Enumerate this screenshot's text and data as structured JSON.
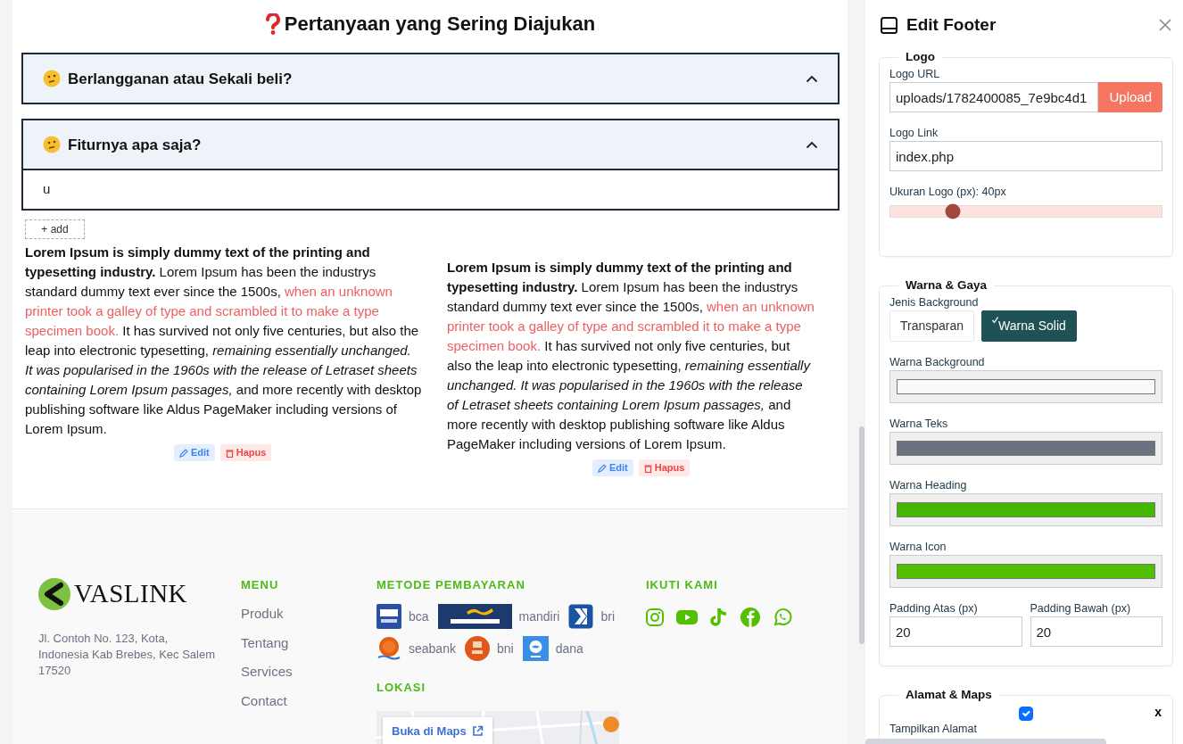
{
  "faq": {
    "title": "Pertanyaan yang Sering Diajukan",
    "items": [
      {
        "question": "Berlangganan atau Sekali beli?",
        "expanded": false
      },
      {
        "question": "Fiturnya apa saja?",
        "expanded": true,
        "answer": "u"
      }
    ]
  },
  "content_columns": [
    {
      "add_button": "+ add",
      "tools": [
        "Edit",
        "Hapus"
      ],
      "segments": [
        {
          "kind": "bold",
          "text": "Lorem Ipsum is simply dummy text of the printing and typesetting industry."
        },
        {
          "kind": "normal",
          "text": " Lorem Ipsum has been the industrys standard dummy text ever since the 1500s, "
        },
        {
          "kind": "red",
          "text": "when an unknown printer took a galley of type and scrambled it to make a type specimen book."
        },
        {
          "kind": "normal",
          "text": " It has survived not only five centuries, but also the leap into electronic typesetting, "
        },
        {
          "kind": "italic",
          "text": "remaining essentially unchanged. It was popularised in the 1960s with the release of Letraset sheets containing Lorem Ipsum passages,"
        },
        {
          "kind": "normal",
          "text": " and more recently with desktop publishing software like Aldus PageMaker including versions of Lorem Ipsum."
        }
      ]
    },
    {
      "tools": [
        "Edit",
        "Hapus"
      ],
      "segments": [
        {
          "kind": "bold",
          "text": "Lorem Ipsum is simply dummy text of the printing and typesetting industry."
        },
        {
          "kind": "normal",
          "text": " Lorem Ipsum has been the industrys standard dummy text ever since the 1500s, "
        },
        {
          "kind": "red",
          "text": "when an unknown printer took a galley of type and scrambled it to make a type specimen book."
        },
        {
          "kind": "normal",
          "text": " It has survived not only five centuries, but also the leap into electronic typesetting, "
        },
        {
          "kind": "italic",
          "text": "remaining essentially unchanged. It was popularised in the 1960s with the release of Letraset sheets containing Lorem Ipsum passages,"
        },
        {
          "kind": "normal",
          "text": " and more recently with desktop publishing software like Aldus PageMaker including versions of Lorem Ipsum."
        }
      ]
    }
  ],
  "footer": {
    "brand": "VASLINK",
    "address": "Jl. Contoh No. 123, Kota, Indonesia Kab Brebes, Kec Salem 17520",
    "menu": {
      "heading": "MENU",
      "links": [
        "Produk",
        "Tentang",
        "Services",
        "Contact"
      ]
    },
    "payments": {
      "heading": "METODE PEMBAYARAN",
      "methods": [
        {
          "kind": "bca",
          "name": "bca"
        },
        {
          "kind": "mandiri",
          "name": "mandiri"
        },
        {
          "kind": "bri",
          "name": "bri"
        },
        {
          "kind": "seabank",
          "name": "seabank"
        },
        {
          "kind": "bni",
          "name": "bni"
        },
        {
          "kind": "dana",
          "name": "dana"
        }
      ]
    },
    "location": {
      "heading": "LOKASI",
      "map_button": "Buka di Maps"
    },
    "social": {
      "heading": "IKUTI KAMI",
      "icons": [
        {
          "kind": "instagram"
        },
        {
          "kind": "youtube"
        },
        {
          "kind": "tiktok"
        },
        {
          "kind": "facebook"
        },
        {
          "kind": "whatsapp"
        }
      ]
    }
  },
  "panel": {
    "title": "Edit Footer",
    "sections": [
      {
        "legend": "Logo",
        "fields": [
          {
            "kind": "upload",
            "label": "Logo URL",
            "value": "uploads/1782400085_7e9bc4d1",
            "button": "Upload"
          },
          {
            "kind": "text",
            "label": "Logo Link",
            "value": "index.php"
          },
          {
            "kind": "range",
            "label": "Ukuran Logo (px): 40px",
            "level": 0.23
          }
        ]
      },
      {
        "legend": "Warna & Gaya",
        "fields": [
          {
            "kind": "toggle",
            "label": "Jenis Background",
            "options": [
              {
                "label": "Transparan",
                "selected": false
              },
              {
                "label": "Warna Solid",
                "selected": true
              }
            ]
          },
          {
            "kind": "color",
            "label": "Warna Background",
            "color": "#f9f9f9"
          },
          {
            "kind": "color",
            "label": "Warna Teks",
            "color": "#6b7280"
          },
          {
            "kind": "color",
            "label": "Warna Heading",
            "color": "#44b700"
          },
          {
            "kind": "color",
            "label": "Warna Icon",
            "color": "#52bf00"
          },
          {
            "kind": "pair",
            "fields": [
              {
                "label": "Padding Atas (px)",
                "value": "20"
              },
              {
                "label": "Padding Bawah (px)",
                "value": "20"
              }
            ]
          }
        ]
      },
      {
        "legend": "Alamat & Maps",
        "close_label": "x",
        "fields": [
          {
            "kind": "checkbox",
            "label": "Tampilkan Alamat",
            "checked": true
          }
        ]
      }
    ]
  }
}
